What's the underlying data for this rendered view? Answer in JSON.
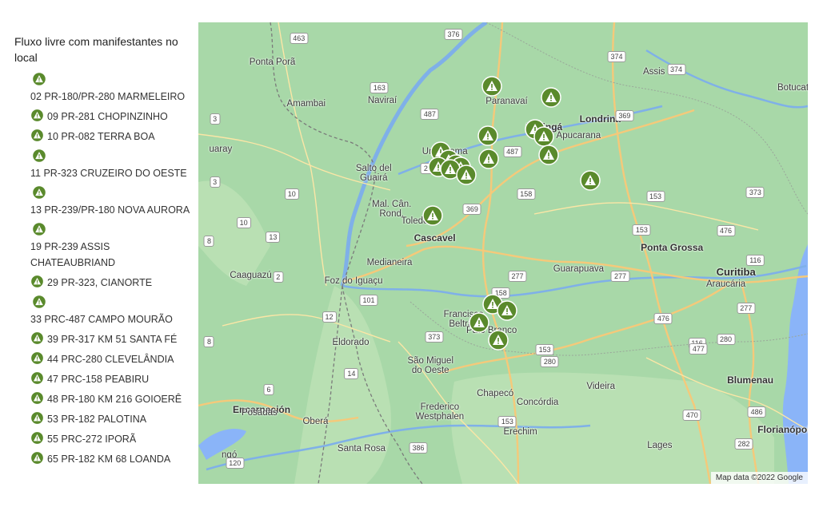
{
  "legend": {
    "title": "Fluxo livre com manifestantes no local",
    "items": [
      {
        "label": "02 PR-180/PR-280 MARMELEIRO",
        "layout": "stacked"
      },
      {
        "label": "09 PR-281 CHOPINZINHO",
        "layout": "inline"
      },
      {
        "label": "10 PR-082 TERRA BOA",
        "layout": "inline"
      },
      {
        "label": "11 PR-323 CRUZEIRO DO OESTE",
        "layout": "stacked"
      },
      {
        "label": "13 PR-239/PR-180 NOVA AURORA",
        "layout": "stacked"
      },
      {
        "label": "19 PR-239 ASSIS CHATEAUBRIAND",
        "layout": "stacked"
      },
      {
        "label": "29 PR-323, CIANORTE",
        "layout": "inline"
      },
      {
        "label": "33 PRC-487 CAMPO MOURÃO",
        "layout": "stacked"
      },
      {
        "label": "39 PR-317 KM 51 SANTA FÉ",
        "layout": "inline"
      },
      {
        "label": "44 PRC-280 CLEVELÂNDIA",
        "layout": "inline"
      },
      {
        "label": "47 PRC-158 PEABIRU",
        "layout": "inline"
      },
      {
        "label": "48 PR-180 KM 216 GOIOERÊ",
        "layout": "inline"
      },
      {
        "label": "53 PR-182 PALOTINA",
        "layout": "inline"
      },
      {
        "label": "55 PRC-272 IPORÃ",
        "layout": "inline"
      },
      {
        "label": "65 PR-182 KM 68 LOANDA",
        "layout": "inline"
      }
    ]
  },
  "colors": {
    "marker": "#5a8a2c",
    "marker_ring": "#ffffff",
    "land": "#a8d8a8",
    "water": "#8ab4f8",
    "river": "#7fb0e8",
    "road_major": "#f5c97a",
    "road_minor": "#fbe6a6",
    "border": "#7a7a7a"
  },
  "map": {
    "markers": [
      {
        "lat": -22.86,
        "lng": -52.67
      },
      {
        "lat": -23.02,
        "lng": -51.84
      },
      {
        "lat": -23.46,
        "lng": -52.07
      },
      {
        "lat": -23.55,
        "lng": -52.72
      },
      {
        "lat": -23.56,
        "lng": -51.94
      },
      {
        "lat": -23.81,
        "lng": -51.88
      },
      {
        "lat": -23.76,
        "lng": -53.38
      },
      {
        "lat": -23.88,
        "lng": -53.27
      },
      {
        "lat": -23.86,
        "lng": -52.71
      },
      {
        "lat": -23.94,
        "lng": -53.17
      },
      {
        "lat": -23.97,
        "lng": -53.1
      },
      {
        "lat": -23.97,
        "lng": -53.41
      },
      {
        "lat": -24.01,
        "lng": -53.25
      },
      {
        "lat": -24.08,
        "lng": -53.02
      },
      {
        "lat": -24.16,
        "lng": -51.3
      },
      {
        "lat": -24.65,
        "lng": -53.49
      },
      {
        "lat": -25.87,
        "lng": -52.65
      },
      {
        "lat": -25.96,
        "lng": -52.45
      },
      {
        "lat": -26.12,
        "lng": -52.84
      },
      {
        "lat": -26.37,
        "lng": -52.58
      }
    ],
    "places": [
      {
        "name": "Ponta Porã",
        "lat": -22.53,
        "lng": -55.72,
        "class": ""
      },
      {
        "name": "Amambai",
        "lat": -23.1,
        "lng": -55.25,
        "class": ""
      },
      {
        "name": "Naviraí",
        "lat": -23.06,
        "lng": -54.19,
        "class": ""
      },
      {
        "name": "Paranavaí",
        "lat": -23.07,
        "lng": -52.46,
        "class": ""
      },
      {
        "name": "Assis",
        "lat": -22.66,
        "lng": -50.41,
        "class": ""
      },
      {
        "name": "Botucatu",
        "lat": -22.88,
        "lng": -48.44,
        "class": ""
      },
      {
        "name": "Maringá",
        "lat": -23.42,
        "lng": -51.94,
        "class": "mid"
      },
      {
        "name": "Londrina",
        "lat": -23.31,
        "lng": -51.16,
        "class": "mid"
      },
      {
        "name": "Apucarana",
        "lat": -23.55,
        "lng": -51.46,
        "class": ""
      },
      {
        "name": "Umuarama",
        "lat": -23.76,
        "lng": -53.32,
        "class": ""
      },
      {
        "name": "Salto del\nGuairá",
        "lat": -24.06,
        "lng": -54.31,
        "class": ""
      },
      {
        "name": "Mal. Cân.\nRond.",
        "lat": -24.56,
        "lng": -54.06,
        "class": ""
      },
      {
        "name": "Toledo",
        "lat": -24.72,
        "lng": -53.74,
        "class": ""
      },
      {
        "name": "Cascavel",
        "lat": -24.96,
        "lng": -53.46,
        "class": "mid"
      },
      {
        "name": "Ponta Grossa",
        "lat": -25.09,
        "lng": -50.16,
        "class": "mid"
      },
      {
        "name": "Curitiba",
        "lat": -25.43,
        "lng": -49.27,
        "class": "big"
      },
      {
        "name": "Guarapuava",
        "lat": -25.39,
        "lng": -51.46,
        "class": ""
      },
      {
        "name": "Caaguazú",
        "lat": -25.47,
        "lng": -56.02,
        "class": ""
      },
      {
        "name": "Medianeira",
        "lat": -25.3,
        "lng": -54.09,
        "class": ""
      },
      {
        "name": "Foz do Iguaçu",
        "lat": -25.55,
        "lng": -54.59,
        "class": ""
      },
      {
        "name": "Araucária",
        "lat": -25.59,
        "lng": -49.41,
        "class": ""
      },
      {
        "name": "Francisco\nBeltrão",
        "lat": -26.08,
        "lng": -53.06,
        "class": ""
      },
      {
        "name": "Pato Branco",
        "lat": -26.23,
        "lng": -52.67,
        "class": ""
      },
      {
        "name": "Eldorado",
        "lat": -26.4,
        "lng": -54.63,
        "class": ""
      },
      {
        "name": "São Miguel\ndo Oeste",
        "lat": -26.72,
        "lng": -53.52,
        "class": ""
      },
      {
        "name": "Blumenau",
        "lat": -26.92,
        "lng": -49.07,
        "class": "mid"
      },
      {
        "name": "Encarnación",
        "lat": -27.33,
        "lng": -55.87,
        "class": "mid"
      },
      {
        "name": "Videira",
        "lat": -27.01,
        "lng": -51.15,
        "class": ""
      },
      {
        "name": "Chapecó",
        "lat": -27.1,
        "lng": -52.62,
        "class": ""
      },
      {
        "name": "Concórdia",
        "lat": -27.23,
        "lng": -52.03,
        "class": ""
      },
      {
        "name": "Frederico\nWestphalen",
        "lat": -27.36,
        "lng": -53.39,
        "class": ""
      },
      {
        "name": "Posadas",
        "lat": -27.37,
        "lng": -55.9,
        "class": ""
      },
      {
        "name": "Oberá",
        "lat": -27.49,
        "lng": -55.12,
        "class": ""
      },
      {
        "name": "Erechim",
        "lat": -27.63,
        "lng": -52.27,
        "class": ""
      },
      {
        "name": "Florianópolis",
        "lat": -27.6,
        "lng": -48.55,
        "class": "mid"
      },
      {
        "name": "Lages",
        "lat": -27.82,
        "lng": -50.33,
        "class": ""
      },
      {
        "name": "Santa Rosa",
        "lat": -27.87,
        "lng": -54.48,
        "class": ""
      },
      {
        "name": "ngó",
        "lat": -27.95,
        "lng": -56.32,
        "class": ""
      },
      {
        "name": "uaray",
        "lat": -23.73,
        "lng": -56.44,
        "class": ""
      }
    ],
    "shields": [
      {
        "label": "463",
        "lat": -22.2,
        "lng": -55.35
      },
      {
        "label": "376",
        "lat": -22.15,
        "lng": -53.2
      },
      {
        "label": "374",
        "lat": -22.45,
        "lng": -50.93
      },
      {
        "label": "374",
        "lat": -22.63,
        "lng": -50.1
      },
      {
        "label": "163",
        "lat": -22.88,
        "lng": -54.23
      },
      {
        "label": "487",
        "lat": -23.25,
        "lng": -53.53
      },
      {
        "label": "369",
        "lat": -23.27,
        "lng": -50.82
      },
      {
        "label": "487",
        "lat": -23.76,
        "lng": -52.38
      },
      {
        "label": "272",
        "lat": -24.0,
        "lng": -53.53
      },
      {
        "label": "158",
        "lat": -24.35,
        "lng": -52.19
      },
      {
        "label": "369",
        "lat": -24.56,
        "lng": -52.94
      },
      {
        "label": "3",
        "lat": -23.31,
        "lng": -56.52
      },
      {
        "label": "3",
        "lat": -24.18,
        "lng": -56.52
      },
      {
        "label": "10",
        "lat": -24.35,
        "lng": -55.45
      },
      {
        "label": "10",
        "lat": -24.75,
        "lng": -56.12
      },
      {
        "label": "13",
        "lat": -24.95,
        "lng": -55.71
      },
      {
        "label": "8",
        "lat": -25.0,
        "lng": -56.6
      },
      {
        "label": "153",
        "lat": -24.38,
        "lng": -50.39
      },
      {
        "label": "373",
        "lat": -24.33,
        "lng": -49.0
      },
      {
        "label": "476",
        "lat": -24.86,
        "lng": -49.41
      },
      {
        "label": "153",
        "lat": -24.85,
        "lng": -50.58
      },
      {
        "label": "277",
        "lat": -25.48,
        "lng": -52.31
      },
      {
        "label": "116",
        "lat": -25.26,
        "lng": -49.0
      },
      {
        "label": "277",
        "lat": -25.48,
        "lng": -50.88
      },
      {
        "label": "277",
        "lat": -25.92,
        "lng": -49.13
      },
      {
        "label": "2",
        "lat": -25.5,
        "lng": -55.64
      },
      {
        "label": "101",
        "lat": -25.81,
        "lng": -54.38
      },
      {
        "label": "12",
        "lat": -26.05,
        "lng": -54.93
      },
      {
        "label": "158",
        "lat": -25.72,
        "lng": -52.54
      },
      {
        "label": "476",
        "lat": -26.07,
        "lng": -50.28
      },
      {
        "label": "280",
        "lat": -26.35,
        "lng": -49.41
      },
      {
        "label": "116",
        "lat": -26.41,
        "lng": -49.81
      },
      {
        "label": "8",
        "lat": -26.39,
        "lng": -56.6
      },
      {
        "label": "373",
        "lat": -26.32,
        "lng": -53.47
      },
      {
        "label": "153",
        "lat": -26.5,
        "lng": -51.93
      },
      {
        "label": "280",
        "lat": -26.66,
        "lng": -51.86
      },
      {
        "label": "477",
        "lat": -26.49,
        "lng": -49.79
      },
      {
        "label": "14",
        "lat": -26.83,
        "lng": -54.62
      },
      {
        "label": "6",
        "lat": -27.05,
        "lng": -55.77
      },
      {
        "label": "470",
        "lat": -27.4,
        "lng": -49.88
      },
      {
        "label": "486",
        "lat": -27.36,
        "lng": -48.98
      },
      {
        "label": "153",
        "lat": -27.49,
        "lng": -52.45
      },
      {
        "label": "386",
        "lat": -27.85,
        "lng": -53.69
      },
      {
        "label": "282",
        "lat": -27.8,
        "lng": -49.16
      },
      {
        "label": "120",
        "lat": -28.06,
        "lng": -56.24
      }
    ],
    "attribution": "Map data ©2022 Google"
  }
}
